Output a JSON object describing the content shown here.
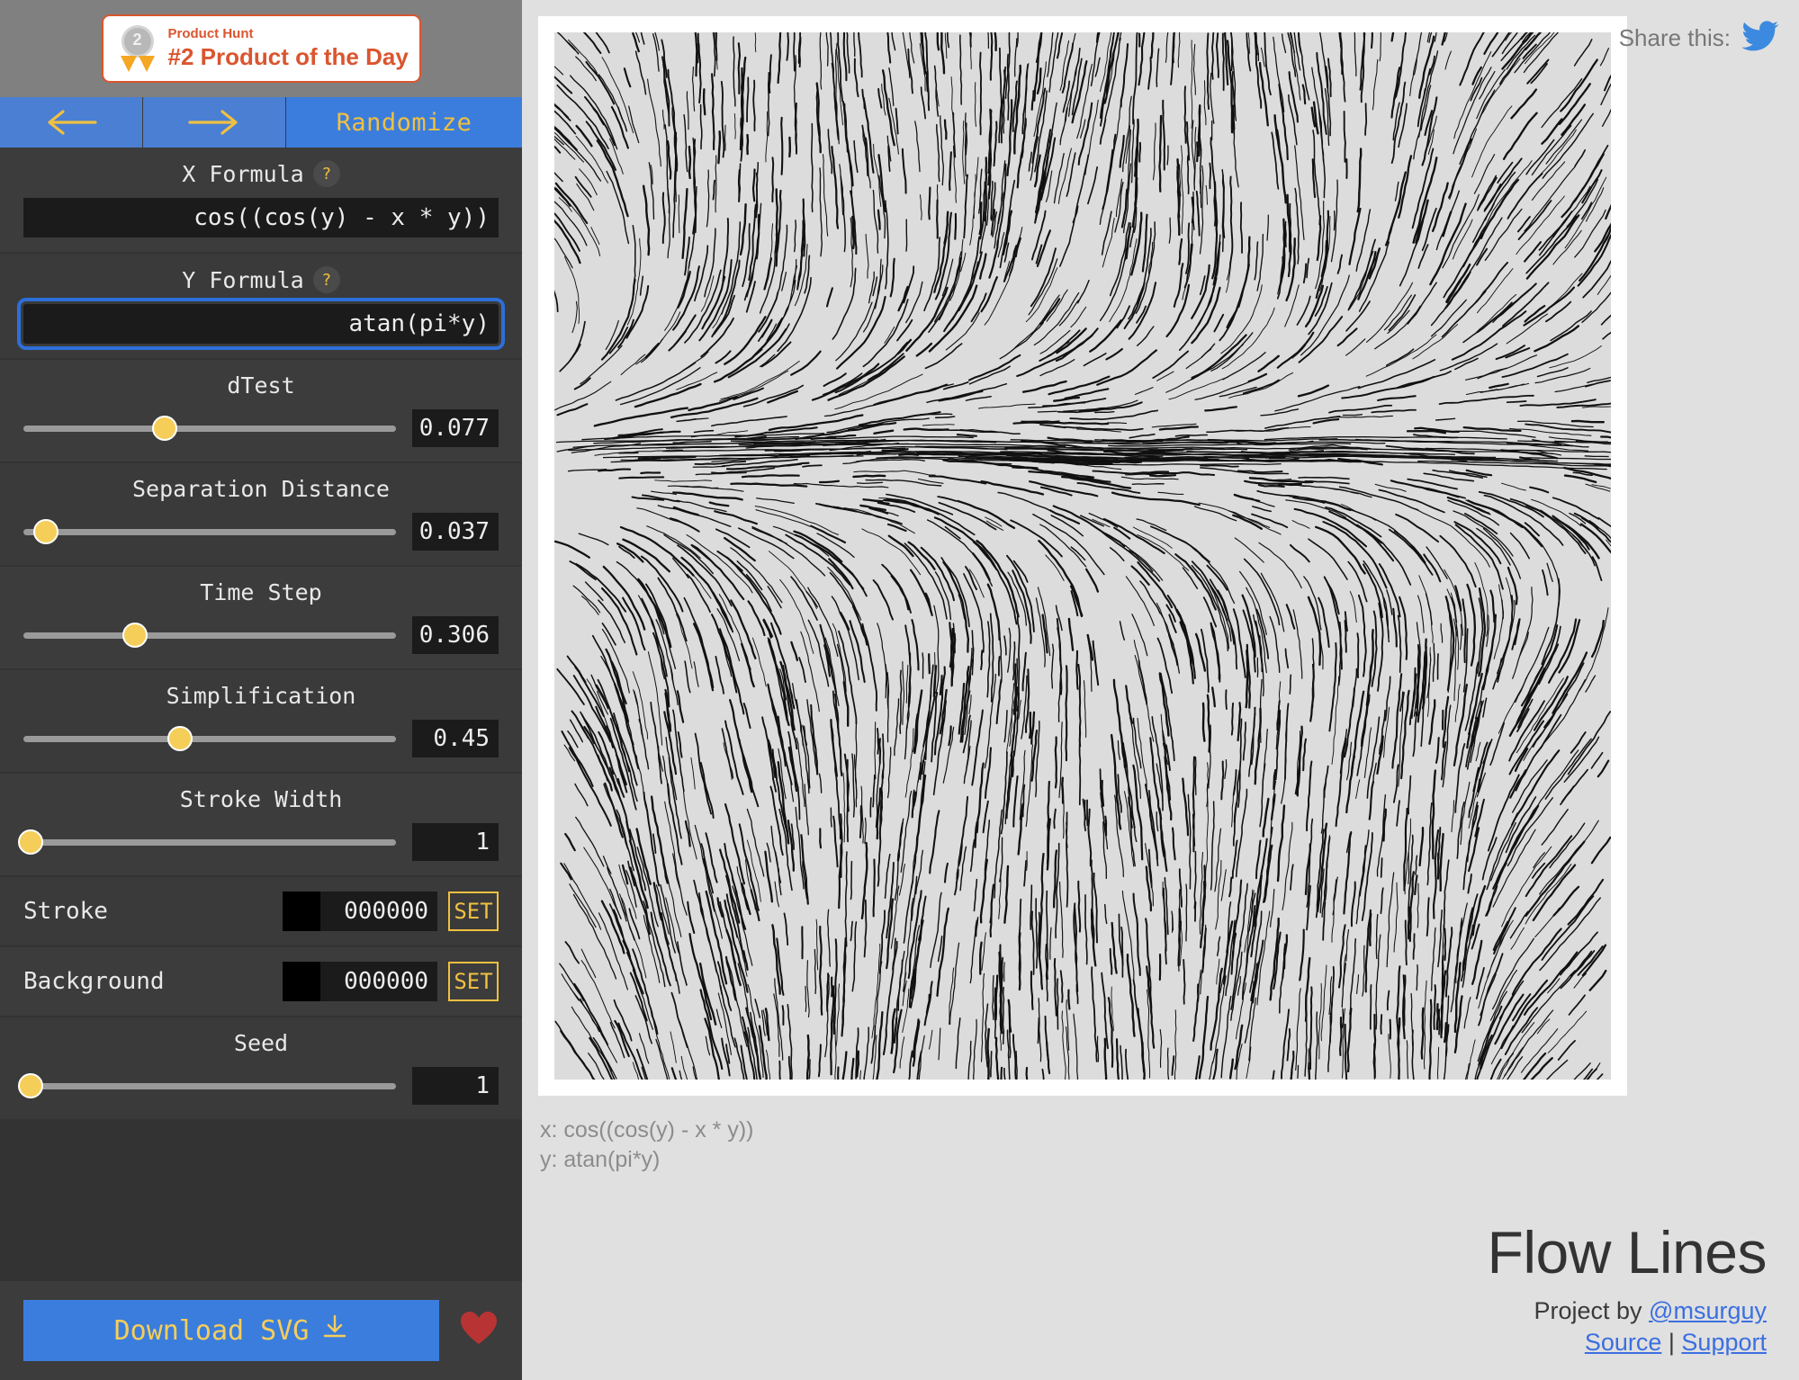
{
  "badge": {
    "rank": "2",
    "site": "Product Hunt",
    "title": "#2 Product of the Day"
  },
  "nav": {
    "prev_icon": "arrow-left-icon",
    "next_icon": "arrow-right-icon",
    "randomize_label": "Randomize"
  },
  "controls": {
    "x_formula": {
      "label": "X Formula",
      "help": "?",
      "value": "cos((cos(y) - x * y))",
      "placeholder": "X Formula"
    },
    "y_formula": {
      "label": "Y Formula",
      "help": "?",
      "value": "atan(pi*y)",
      "placeholder": "Y Formula",
      "focused": true
    },
    "sliders": [
      {
        "label": "dTest",
        "value": "0.077",
        "pct": 38
      },
      {
        "label": "Separation Distance",
        "value": "0.037",
        "pct": 6
      },
      {
        "label": "Time Step",
        "value": "0.306",
        "pct": 30
      },
      {
        "label": "Simplification",
        "value": "0.45",
        "pct": 42
      },
      {
        "label": "Stroke Width",
        "value": "1",
        "pct": 2
      }
    ],
    "colors": [
      {
        "label": "Stroke",
        "hex": "000000",
        "swatch": "#000000",
        "set_label": "SET"
      },
      {
        "label": "Background",
        "hex": "000000",
        "swatch": "#000000",
        "set_label": "SET"
      }
    ],
    "seed": {
      "label": "Seed",
      "value": "1",
      "pct": 2
    }
  },
  "actions": {
    "download_label": "Download SVG",
    "download_icon": "download-icon",
    "heart_icon": "heart-icon"
  },
  "share": {
    "label": "Share this:",
    "icon": "twitter-icon"
  },
  "captions": {
    "x": "x: cos((cos(y) - x * y))",
    "y": "y: atan(pi*y)"
  },
  "footer": {
    "title": "Flow Lines",
    "by_prefix": "Project by ",
    "author": "@msurguy",
    "source": "Source",
    "separator": "|",
    "support": "Support"
  },
  "theme": {
    "accent_blue": "#3b7ddd",
    "accent_yellow": "#f0c040",
    "panel_bg": "#3a3a3a",
    "input_bg": "#1b1b1b",
    "canvas_bg": "#dcdcdc",
    "stroke_color": "#111111",
    "link_blue": "#3b6fe0",
    "ph_orange": "#da552f"
  }
}
